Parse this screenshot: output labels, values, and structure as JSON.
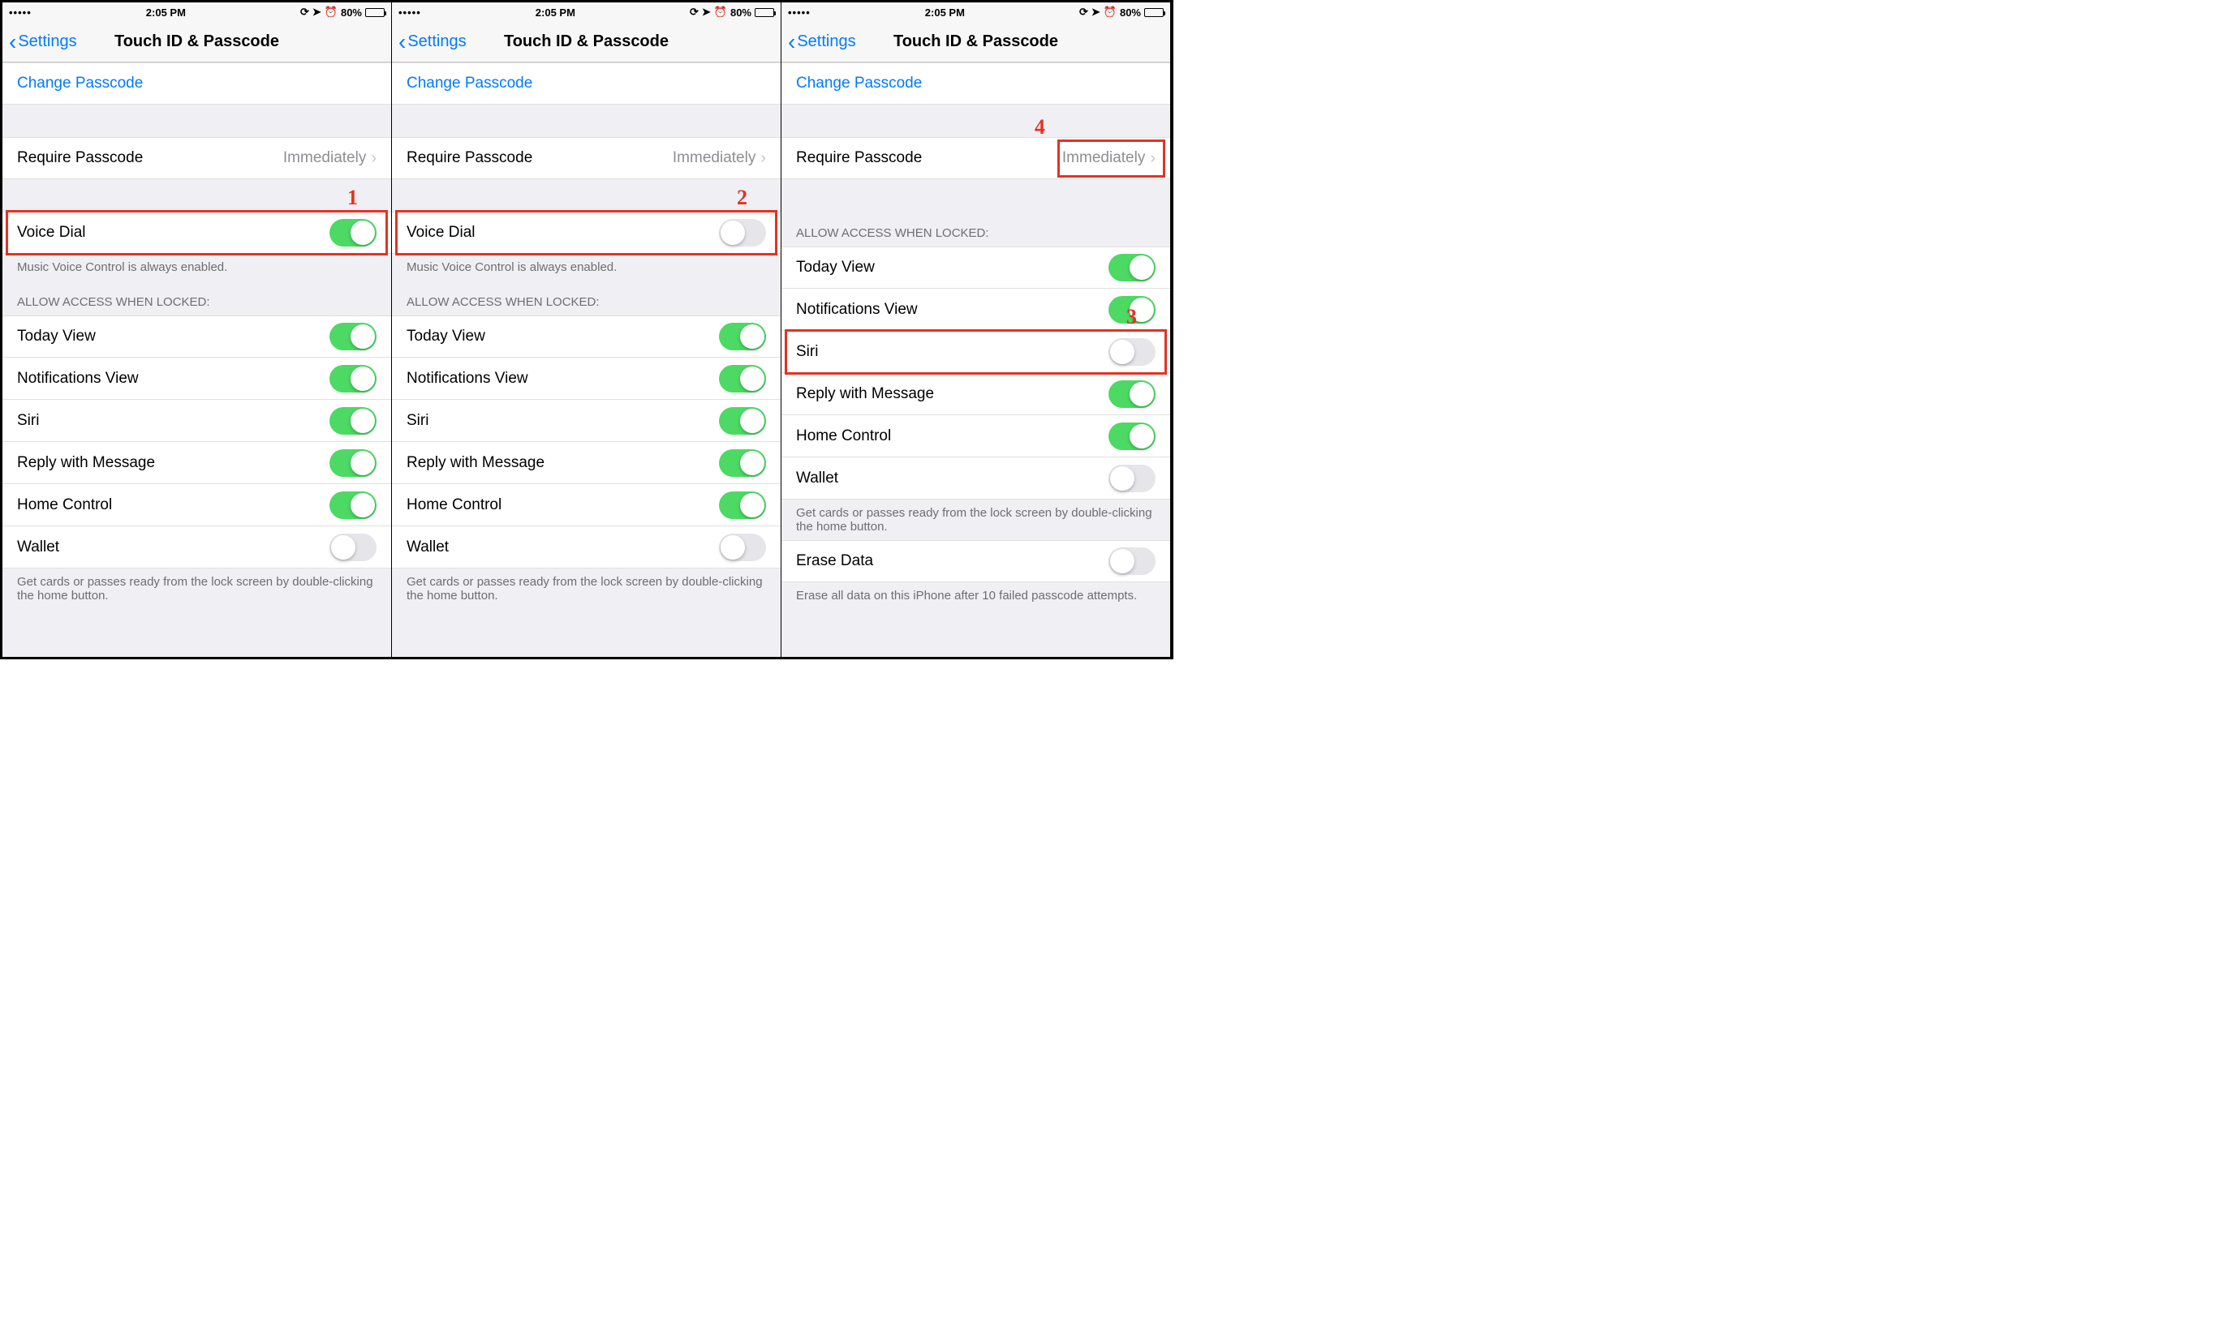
{
  "statusbar": {
    "signal": "•••••",
    "time": "2:05 PM",
    "battery_pct": "80%",
    "icons": [
      "rotation-lock",
      "location",
      "alarm"
    ]
  },
  "nav": {
    "back_label": "Settings",
    "title": "Touch ID & Passcode"
  },
  "change_passcode": "Change Passcode",
  "require_passcode": {
    "label": "Require Passcode",
    "value": "Immediately"
  },
  "voice_dial": {
    "label": "Voice Dial",
    "footnote": "Music Voice Control is always enabled."
  },
  "allow_header": "ALLOW ACCESS WHEN LOCKED:",
  "allow_items": {
    "today": "Today View",
    "notifications": "Notifications View",
    "siri": "Siri",
    "reply": "Reply with Message",
    "home": "Home Control",
    "wallet": "Wallet"
  },
  "wallet_footnote": "Get cards or passes ready from the lock screen by double-clicking the home button.",
  "erase_data": {
    "label": "Erase Data",
    "footnote": "Erase all data on this iPhone after 10 failed passcode attempts."
  },
  "panels": [
    {
      "voice_dial_on": true,
      "siri_on": true,
      "scrolled": false,
      "annotation": {
        "target": "voice-dial-row",
        "label": "1",
        "label_pos": "top-right"
      }
    },
    {
      "voice_dial_on": false,
      "siri_on": true,
      "scrolled": false,
      "annotation": {
        "target": "voice-dial-row",
        "label": "2",
        "label_pos": "top-right"
      }
    },
    {
      "voice_dial_on": false,
      "siri_on": false,
      "scrolled": true,
      "annotation": {
        "target": "siri-row",
        "label": "3",
        "label_pos": "top-right"
      },
      "annotation2": {
        "target": "require-passcode-value",
        "label": "4",
        "label_pos": "top-left"
      }
    }
  ],
  "allow_states": {
    "today": true,
    "notifications": true,
    "reply": true,
    "home": true,
    "wallet": false
  },
  "erase_data_on": false
}
